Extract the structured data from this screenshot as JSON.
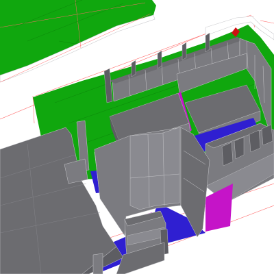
{
  "viewport": {
    "background": "#ffffff"
  },
  "palette": {
    "floor_green": "#10a70e",
    "floor_green_dark": "#0d8c0b",
    "wall_grey": "#7b7b80",
    "wall_grey_dark": "#5d5d62",
    "wall_grey_light": "#9a9aa0",
    "top_grey": "#6c6c70",
    "accent_blue": "#2f1fd1",
    "accent_magenta": "#c514c8",
    "guide_red": "#ff6a6a",
    "wire_white": "#c9c9cc",
    "marker_red": "#cc1111"
  }
}
